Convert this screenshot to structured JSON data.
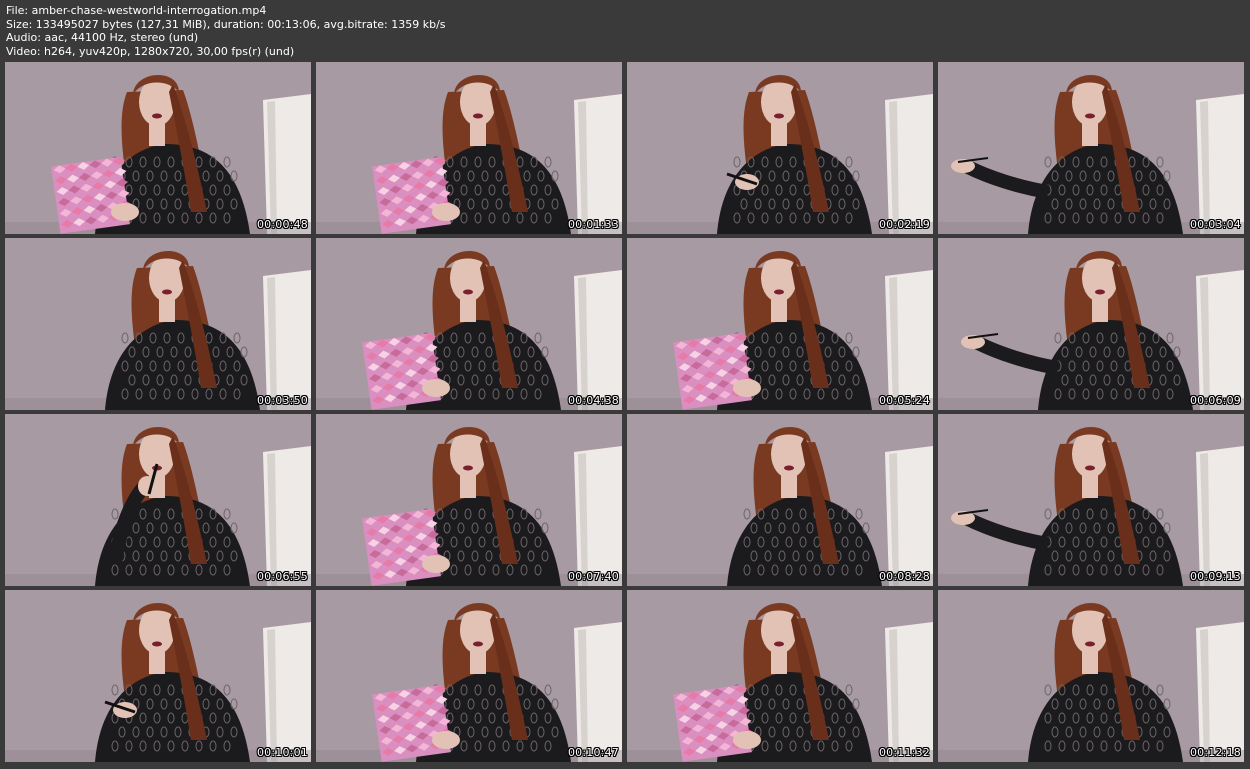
{
  "header": {
    "file_line": "File: amber-chase-westworld-interrogation.mp4",
    "size_line": "Size: 133495027 bytes (127,31 MiB), duration: 00:13:06, avg.bitrate: 1359 kb/s",
    "audio_line": "Audio: aac, 44100 Hz, stereo (und)",
    "video_line": "Video: h264, yuv420p, 1280x720, 30,00 fps(r) (und)"
  },
  "colors": {
    "background": "#3a3a3a",
    "wall": "#a89aa3",
    "door": "#eeeae8",
    "hair": "#7a3a22",
    "dress": "#1b1b1e",
    "skin": "#e2c2b4",
    "notebook": "#d98fc0"
  },
  "thumbnails": [
    {
      "timestamp": "00:00:48",
      "pose": "notebook"
    },
    {
      "timestamp": "00:01:33",
      "pose": "notebook"
    },
    {
      "timestamp": "00:02:19",
      "pose": "pen"
    },
    {
      "timestamp": "00:03:04",
      "pose": "gesture"
    },
    {
      "timestamp": "00:03:50",
      "pose": "plain"
    },
    {
      "timestamp": "00:04:38",
      "pose": "notebook"
    },
    {
      "timestamp": "00:05:24",
      "pose": "notebook"
    },
    {
      "timestamp": "00:06:09",
      "pose": "gesture"
    },
    {
      "timestamp": "00:06:55",
      "pose": "pen-mouth"
    },
    {
      "timestamp": "00:07:40",
      "pose": "notebook"
    },
    {
      "timestamp": "00:08:28",
      "pose": "plain"
    },
    {
      "timestamp": "00:09:13",
      "pose": "gesture"
    },
    {
      "timestamp": "00:10:01",
      "pose": "pen"
    },
    {
      "timestamp": "00:10:47",
      "pose": "notebook"
    },
    {
      "timestamp": "00:11:32",
      "pose": "notebook"
    },
    {
      "timestamp": "00:12:18",
      "pose": "plain"
    }
  ]
}
